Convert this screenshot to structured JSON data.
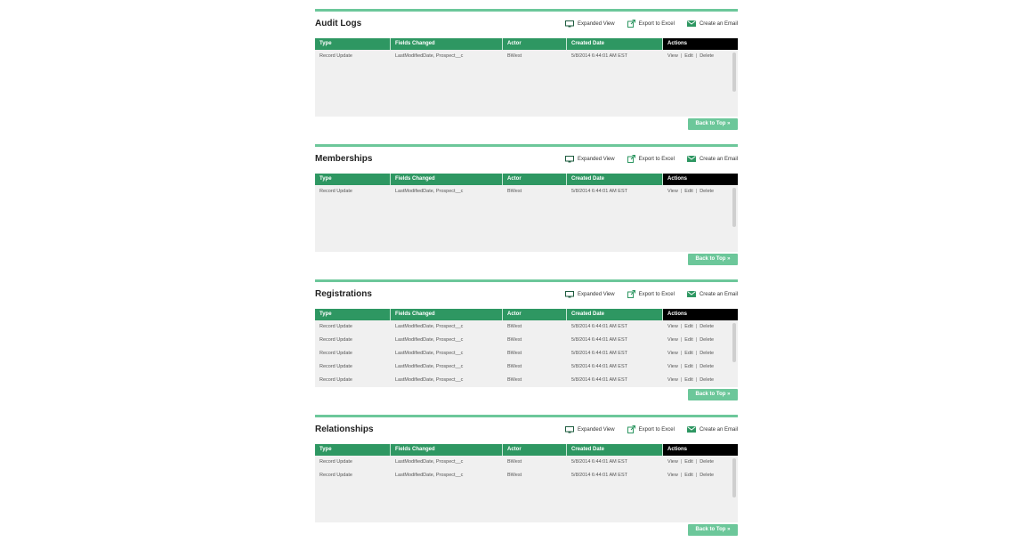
{
  "toolbar": {
    "expanded": "Expanded View",
    "export": "Export to Excel",
    "email": "Create an Email"
  },
  "columns": [
    "Type",
    "Fields Changed",
    "Actor",
    "Created Date",
    "Actions"
  ],
  "action_labels": {
    "view": "View",
    "edit": "Edit",
    "delete": "Delete",
    "separator": "|"
  },
  "back_to_top": "Back to Top »",
  "colors": {
    "accent": "#2e9762",
    "accent_light": "#6cc79a",
    "actions_header": "#000000"
  },
  "sections": [
    {
      "title": "Audit Logs",
      "rows": [
        {
          "type": "Record Update",
          "fields": "LastModifiedDate, Prospect__c",
          "actor": "BWest",
          "date": "5/8/2014 6:44:01 AM EST"
        }
      ]
    },
    {
      "title": "Memberships",
      "rows": [
        {
          "type": "Record Update",
          "fields": "LastModifiedDate, Prospect__c",
          "actor": "BWest",
          "date": "5/8/2014 6:44:01 AM EST"
        }
      ]
    },
    {
      "title": "Registrations",
      "rows": [
        {
          "type": "Record Update",
          "fields": "LastModifiedDate, Prospect__c",
          "actor": "BWest",
          "date": "5/8/2014 6:44:01 AM EST"
        },
        {
          "type": "Record Update",
          "fields": "LastModifiedDate, Prospect__c",
          "actor": "BWest",
          "date": "5/8/2014 6:44:01 AM EST"
        },
        {
          "type": "Record Update",
          "fields": "LastModifiedDate, Prospect__c",
          "actor": "BWest",
          "date": "5/8/2014 6:44:01 AM EST"
        },
        {
          "type": "Record Update",
          "fields": "LastModifiedDate, Prospect__c",
          "actor": "BWest",
          "date": "5/8/2014 6:44:01 AM EST"
        },
        {
          "type": "Record Update",
          "fields": "LastModifiedDate, Prospect__c",
          "actor": "BWest",
          "date": "5/8/2014 6:44:01 AM EST"
        }
      ]
    },
    {
      "title": "Relationships",
      "rows": [
        {
          "type": "Record Update",
          "fields": "LastModifiedDate, Prospect__c",
          "actor": "BWest",
          "date": "5/8/2014 6:44:01 AM EST"
        },
        {
          "type": "Record Update",
          "fields": "LastModifiedDate, Prospect__c",
          "actor": "BWest",
          "date": "5/8/2014 6:44:01 AM EST"
        }
      ]
    }
  ]
}
